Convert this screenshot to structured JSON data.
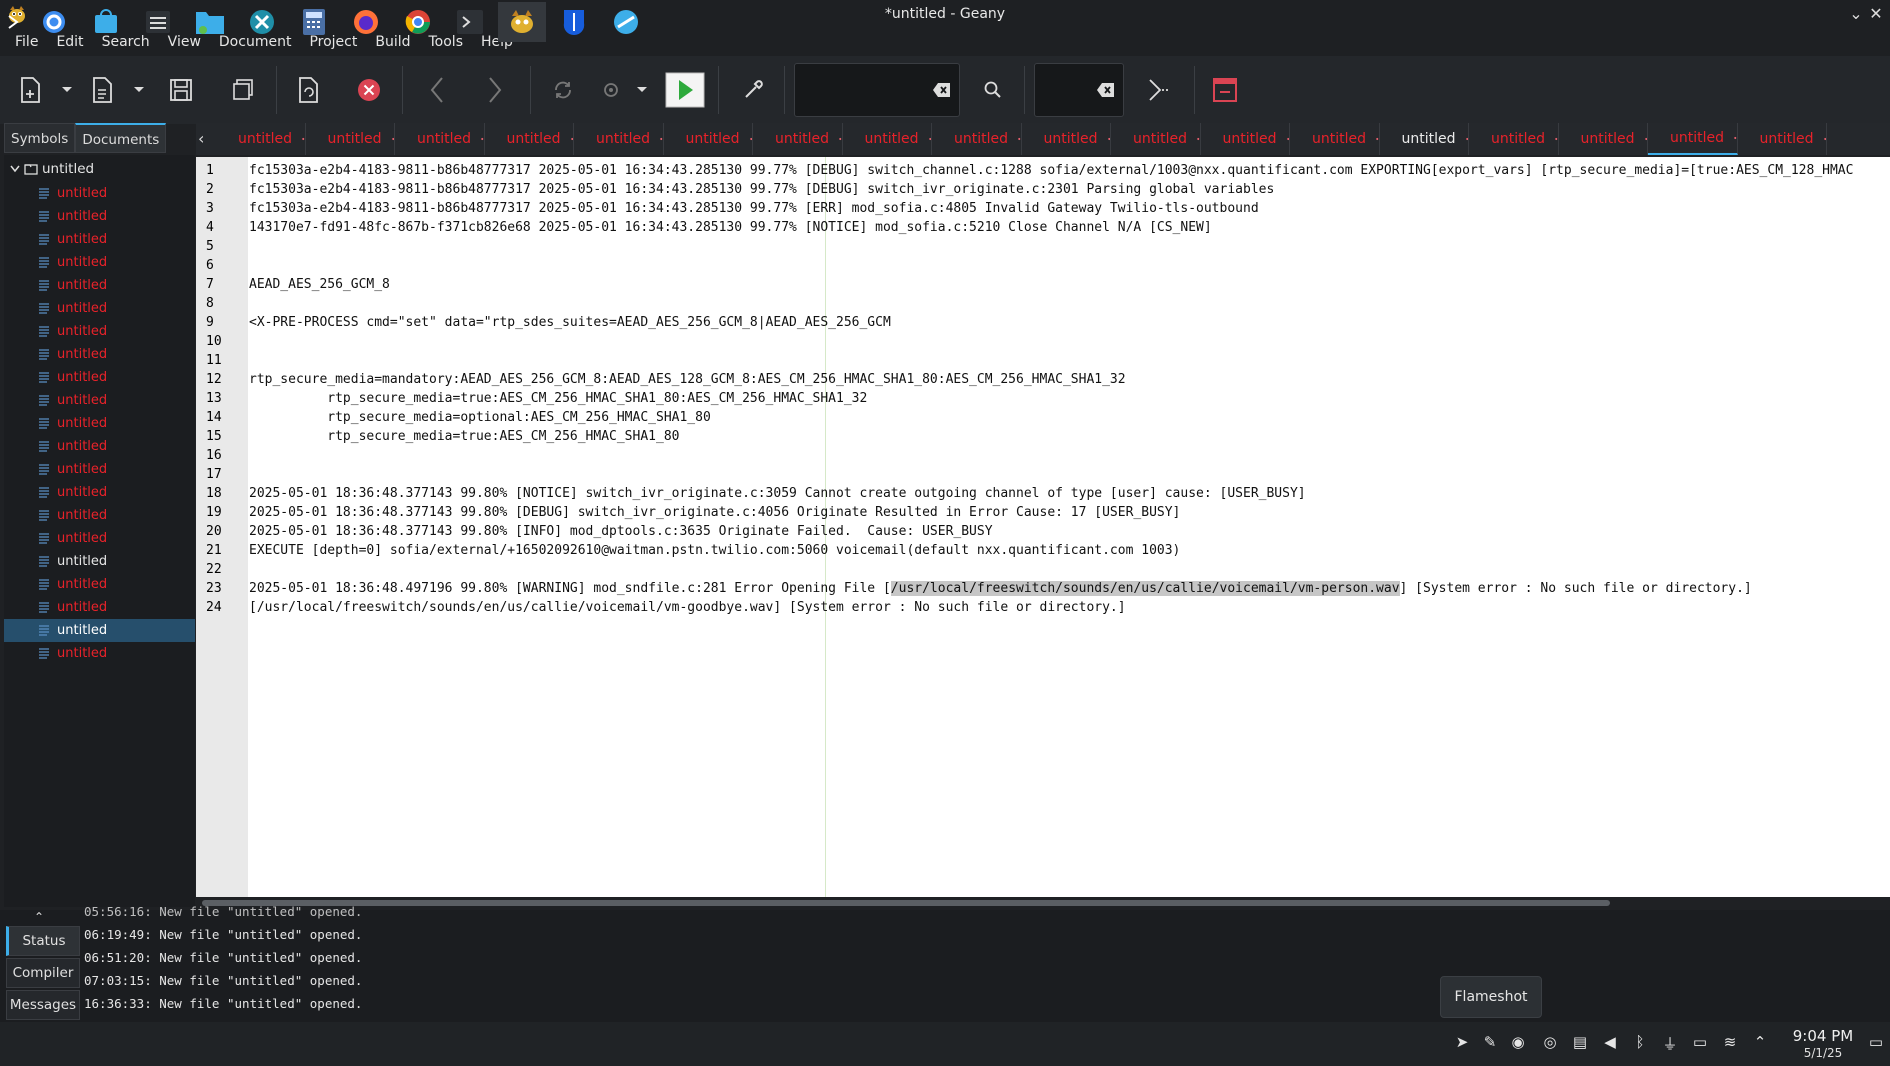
{
  "window": {
    "title": "*untitled - Geany"
  },
  "menu": [
    "File",
    "Edit",
    "Search",
    "View",
    "Document",
    "Project",
    "Build",
    "Tools",
    "Help"
  ],
  "sidebar": {
    "tabs": [
      "Symbols",
      "Documents"
    ],
    "root": "untitled",
    "items": [
      {
        "label": "untitled",
        "state": "modified"
      },
      {
        "label": "untitled",
        "state": "modified"
      },
      {
        "label": "untitled",
        "state": "modified"
      },
      {
        "label": "untitled",
        "state": "modified"
      },
      {
        "label": "untitled",
        "state": "modified"
      },
      {
        "label": "untitled",
        "state": "modified"
      },
      {
        "label": "untitled",
        "state": "modified"
      },
      {
        "label": "untitled",
        "state": "modified"
      },
      {
        "label": "untitled",
        "state": "modified"
      },
      {
        "label": "untitled",
        "state": "modified"
      },
      {
        "label": "untitled",
        "state": "modified"
      },
      {
        "label": "untitled",
        "state": "modified"
      },
      {
        "label": "untitled",
        "state": "modified"
      },
      {
        "label": "untitled",
        "state": "modified"
      },
      {
        "label": "untitled",
        "state": "modified"
      },
      {
        "label": "untitled",
        "state": "modified"
      },
      {
        "label": "untitled",
        "state": "normal"
      },
      {
        "label": "untitled",
        "state": "modified"
      },
      {
        "label": "untitled",
        "state": "modified"
      },
      {
        "label": "untitled",
        "state": "selected"
      },
      {
        "label": "untitled",
        "state": "modified"
      }
    ]
  },
  "editor_tabs": [
    {
      "label": "untitled",
      "state": "modified"
    },
    {
      "label": "untitled",
      "state": "modified"
    },
    {
      "label": "untitled",
      "state": "modified"
    },
    {
      "label": "untitled",
      "state": "modified"
    },
    {
      "label": "untitled",
      "state": "modified"
    },
    {
      "label": "untitled",
      "state": "modified"
    },
    {
      "label": "untitled",
      "state": "modified"
    },
    {
      "label": "untitled",
      "state": "modified"
    },
    {
      "label": "untitled",
      "state": "modified"
    },
    {
      "label": "untitled",
      "state": "modified"
    },
    {
      "label": "untitled",
      "state": "modified"
    },
    {
      "label": "untitled",
      "state": "modified"
    },
    {
      "label": "untitled",
      "state": "modified"
    },
    {
      "label": "untitled",
      "state": "normal"
    },
    {
      "label": "untitled",
      "state": "modified"
    },
    {
      "label": "untitled",
      "state": "modified"
    },
    {
      "label": "untitled",
      "state": "current"
    },
    {
      "label": "untitled",
      "state": "modified"
    }
  ],
  "code_lines": [
    "fc15303a-e2b4-4183-9811-b86b48777317 2025-05-01 16:34:43.285130 99.77% [DEBUG] switch_channel.c:1288 sofia/external/1003@nxx.quantificant.com EXPORTING[export_vars] [rtp_secure_media]=[true:AES_CM_128_HMAC",
    "fc15303a-e2b4-4183-9811-b86b48777317 2025-05-01 16:34:43.285130 99.77% [DEBUG] switch_ivr_originate.c:2301 Parsing global variables",
    "fc15303a-e2b4-4183-9811-b86b48777317 2025-05-01 16:34:43.285130 99.77% [ERR] mod_sofia.c:4805 Invalid Gateway Twilio-tls-outbound",
    "143170e7-fd91-48fc-867b-f371cb826e68 2025-05-01 16:34:43.285130 99.77% [NOTICE] mod_sofia.c:5210 Close Channel N/A [CS_NEW]",
    "",
    "",
    "AEAD_AES_256_GCM_8",
    "",
    "<X-PRE-PROCESS cmd=\"set\" data=\"rtp_sdes_suites=AEAD_AES_256_GCM_8|AEAD_AES_256_GCM",
    "",
    "",
    "rtp_secure_media=mandatory:AEAD_AES_256_GCM_8:AEAD_AES_128_GCM_8:AES_CM_256_HMAC_SHA1_80:AES_CM_256_HMAC_SHA1_32",
    "          rtp_secure_media=true:AES_CM_256_HMAC_SHA1_80:AES_CM_256_HMAC_SHA1_32",
    "          rtp_secure_media=optional:AES_CM_256_HMAC_SHA1_80",
    "          rtp_secure_media=true:AES_CM_256_HMAC_SHA1_80",
    "",
    "",
    "2025-05-01 18:36:48.377143 99.80% [NOTICE] switch_ivr_originate.c:3059 Cannot create outgoing channel of type [user] cause: [USER_BUSY]",
    "2025-05-01 18:36:48.377143 99.80% [DEBUG] switch_ivr_originate.c:4056 Originate Resulted in Error Cause: 17 [USER_BUSY]",
    "2025-05-01 18:36:48.377143 99.80% [INFO] mod_dptools.c:3635 Originate Failed.  Cause: USER_BUSY",
    "EXECUTE [depth=0] sofia/external/+16502092610@waitman.pstn.twilio.com:5060 voicemail(default nxx.quantificant.com 1003)",
    "",
    "2025-05-01 18:36:48.497196 99.80% [WARNING] mod_sndfile.c:281 Error Opening File [",
    "[/usr/local/freeswitch/sounds/en/us/callie/voicemail/vm-goodbye.wav] [System error : No such file or directory.]"
  ],
  "line23_selected": "/usr/local/freeswitch/sounds/en/us/callie/voicemail/vm-person.wav",
  "line23_after": "] [System error : No such file or directory.]",
  "bottom_tabs": [
    "Status",
    "Compiler",
    "Messages"
  ],
  "messages": [
    "05:56:16: New file \"untitled\" opened.",
    "06:19:49: New file \"untitled\" opened.",
    "06:51:20: New file \"untitled\" opened.",
    "07:03:15: New file \"untitled\" opened.",
    "16:36:33: New file \"untitled\" opened."
  ],
  "tooltip": "Flameshot",
  "clock": {
    "time": "9:04 PM",
    "date": "5/1/25"
  },
  "colors": {
    "modified": "#e8222a",
    "accent": "#3daee9",
    "selected_row": "#264f6c"
  }
}
